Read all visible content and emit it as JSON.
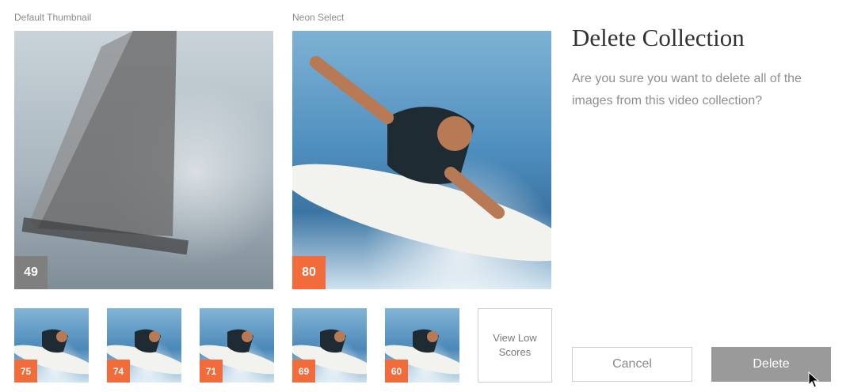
{
  "left_panel": {
    "label": "Default Thumbnail",
    "score": "49"
  },
  "right_panel": {
    "label": "Neon Select",
    "score": "80"
  },
  "small_thumbs": [
    "75",
    "74",
    "71",
    "69",
    "60"
  ],
  "view_low_scores": "View Low\nScores",
  "dialog": {
    "title": "Delete Collection",
    "message": "Are you sure you want to delete all of the images from this video collection?",
    "cancel_label": "Cancel",
    "delete_label": "Delete"
  },
  "colors": {
    "score_orange": "#f26b3a",
    "score_grey": "#7f7f7f",
    "delete_button": "#9a9a9a"
  }
}
